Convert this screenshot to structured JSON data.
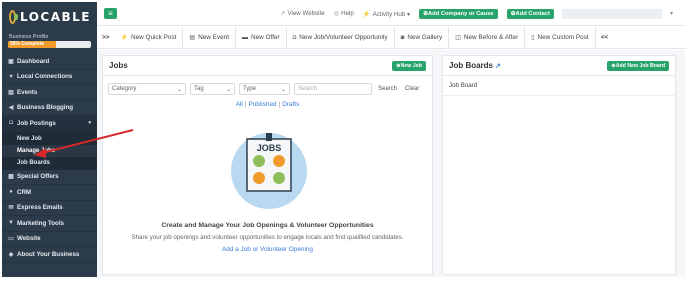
{
  "sidebar": {
    "logo_text": "LOCABLE",
    "profile_label": "Business Profile",
    "profile_progress_text": "58% Complete",
    "profile_progress": 0.58,
    "items": [
      {
        "label": "Dashboard",
        "icon": "dashboard-icon",
        "glyph": "▣"
      },
      {
        "label": "Local Connections",
        "icon": "handshake-icon",
        "glyph": "♥"
      },
      {
        "label": "Events",
        "icon": "calendar-icon",
        "glyph": "▤"
      },
      {
        "label": "Business Blogging",
        "icon": "megaphone-icon",
        "glyph": "◀"
      },
      {
        "label": "Job Postings",
        "icon": "briefcase-icon",
        "glyph": "◘"
      },
      {
        "label": "Special Offers",
        "icon": "offers-icon",
        "glyph": "▦"
      },
      {
        "label": "CRM",
        "icon": "users-icon",
        "glyph": "●"
      },
      {
        "label": "Express Emails",
        "icon": "envelope-icon",
        "glyph": "✉"
      },
      {
        "label": "Marketing Tools",
        "icon": "filter-icon",
        "glyph": "▼"
      },
      {
        "label": "Website",
        "icon": "monitor-icon",
        "glyph": "▭"
      },
      {
        "label": "About Your Business",
        "icon": "map-marker-icon",
        "glyph": "◆"
      }
    ],
    "subitems": [
      "New Job",
      "Manage Jobs",
      "Job Boards"
    ]
  },
  "topbar": {
    "view_website": "View Website",
    "help": "Help",
    "activity_hub": "Activity Hub",
    "add_company": "Add Company or Cause",
    "add_contact": "Add Contact"
  },
  "quickbar": {
    "items": [
      "New Quick Post",
      "New Event",
      "New Offer",
      "New Job/Volunteer Opportunity",
      "New Gallery",
      "New Before & After",
      "New Custom Post"
    ]
  },
  "jobs": {
    "title": "Jobs",
    "new_job_btn": "New Job",
    "filters": {
      "category": "Category",
      "tag": "Tag",
      "type": "Type",
      "search_placeholder": "Search",
      "search_btn": "Search",
      "clear_btn": "Clear"
    },
    "tabs": [
      "All",
      "Published",
      "Drafts"
    ],
    "illustration_text": "JOBS",
    "empty_title": "Create and Manage Your Job Openings & Volunteer Opportunities",
    "empty_desc": "Share your job openings and volunteer opportunities to engage locals and find qualified candidates.",
    "empty_link": "Add a Job or Volunteer Opening"
  },
  "boards": {
    "title": "Job Boards",
    "add_btn": "Add New Job Board",
    "rows": [
      "Job Board"
    ]
  },
  "colors": {
    "sidebar_bg": "#2c3b4a",
    "accent_green": "#28a36a",
    "progress_orange": "#f19b2c",
    "link_blue": "#3a7bd5",
    "annotation_red": "#d62828"
  }
}
